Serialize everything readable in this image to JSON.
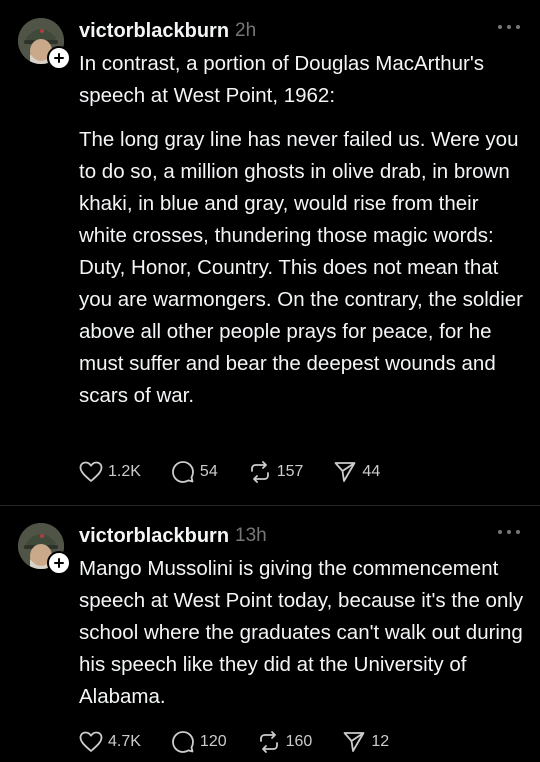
{
  "posts": [
    {
      "username": "victorblackburn",
      "time": "2h",
      "intro": "In contrast, a portion of Douglas MacArthur's speech at West Point, 1962:",
      "quote": "The long gray line has never failed us. Were you to do so, a million ghosts in olive drab, in brown khaki, in blue and gray, would rise from their white crosses, thundering those magic words: Duty, Honor, Country. This does not mean that you are warmongers. On the contrary, the soldier above all other people prays for peace, for he must suffer and bear the deepest wounds and scars of war.",
      "likes": "1.2K",
      "replies": "54",
      "reposts": "157",
      "shares": "44"
    },
    {
      "username": "victorblackburn",
      "time": "13h",
      "body": "Mango Mussolini is giving the commencement speech at West Point today, because it's the only school where the graduates can't walk out during his speech like they did at the University of Alabama.",
      "likes": "4.7K",
      "replies": "120",
      "reposts": "160",
      "shares": "12"
    }
  ],
  "icons": {
    "like": "heart-icon",
    "reply": "comment-icon",
    "repost": "repost-icon",
    "share": "send-icon",
    "more": "more-dots-icon",
    "follow": "plus-icon"
  }
}
